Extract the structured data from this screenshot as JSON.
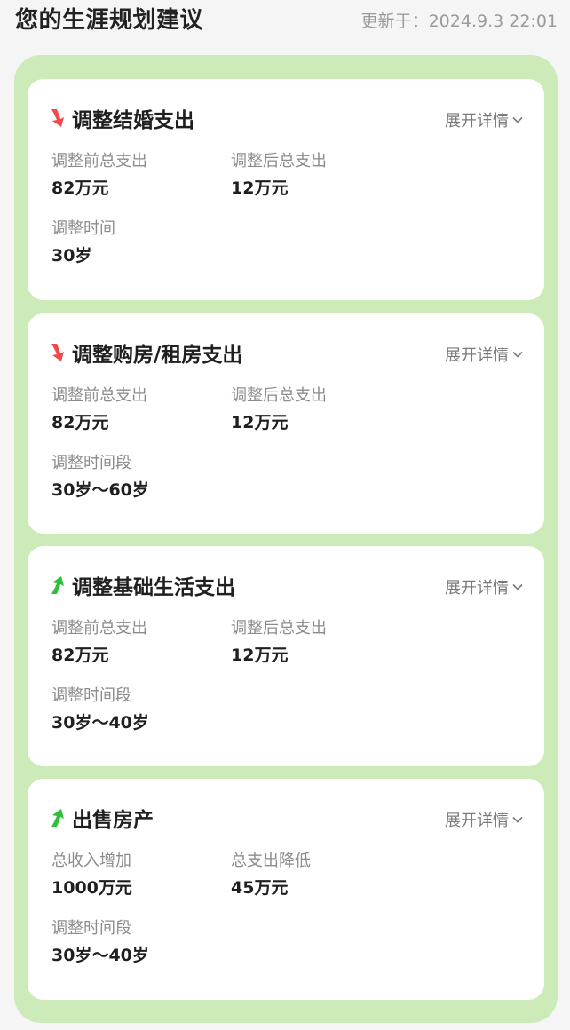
{
  "header": {
    "title": "您的生涯规划建议",
    "update_time": "更新于：2024.9.3 22:01"
  },
  "colors": {
    "panel_bg": "#cdeab9",
    "down_arrow": "#f0494a",
    "up_arrow": "#2fbf3a"
  },
  "cards": [
    {
      "trend": "down",
      "icon": "red-down-arrow-icon",
      "title": "调整结婚支出",
      "expand_label": "展开详情",
      "field1": {
        "label": "调整前总支出",
        "value": "82万元"
      },
      "field2": {
        "label": "调整后总支出",
        "value": "12万元"
      },
      "field3": {
        "label": "调整时间",
        "value": "30岁"
      }
    },
    {
      "trend": "down",
      "icon": "red-down-arrow-icon",
      "title": "调整购房/租房支出",
      "expand_label": "展开详情",
      "field1": {
        "label": "调整前总支出",
        "value": "82万元"
      },
      "field2": {
        "label": "调整后总支出",
        "value": "12万元"
      },
      "field3": {
        "label": "调整时间段",
        "value": "30岁～60岁"
      }
    },
    {
      "trend": "up",
      "icon": "green-up-arrow-icon",
      "title": "调整基础生活支出",
      "expand_label": "展开详情",
      "field1": {
        "label": "调整前总支出",
        "value": "82万元"
      },
      "field2": {
        "label": "调整后总支出",
        "value": "12万元"
      },
      "field3": {
        "label": "调整时间段",
        "value": "30岁～40岁"
      }
    },
    {
      "trend": "up",
      "icon": "green-up-arrow-icon",
      "title": "出售房产",
      "expand_label": "展开详情",
      "field1": {
        "label": "总收入增加",
        "value": "1000万元"
      },
      "field2": {
        "label": "总支出降低",
        "value": "45万元"
      },
      "field3": {
        "label": "调整时间段",
        "value": "30岁～40岁"
      }
    }
  ]
}
